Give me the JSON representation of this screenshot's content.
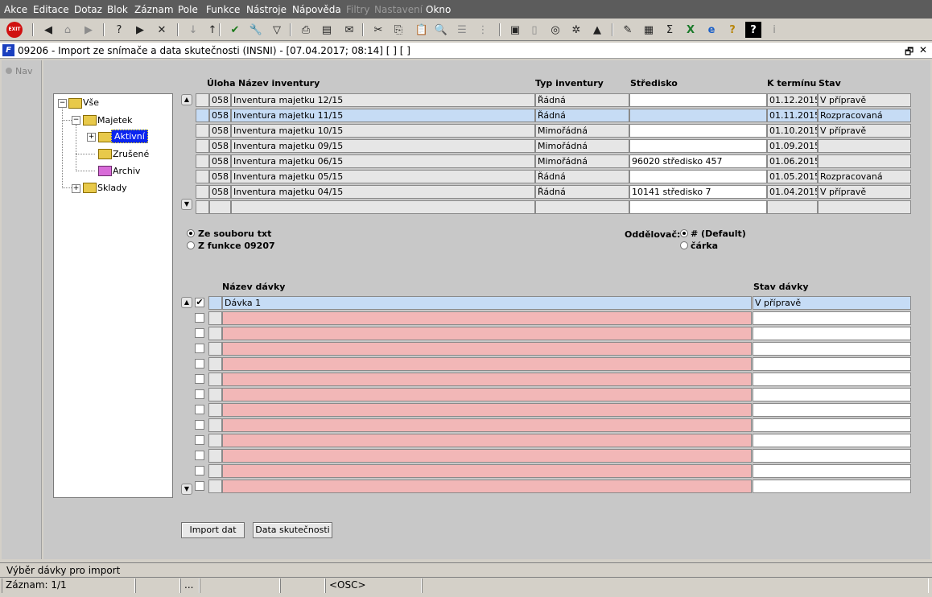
{
  "menu": [
    "Akce",
    "Editace",
    "Dotaz",
    "Blok",
    "Záznam",
    "Pole",
    "Funkce",
    "Nástroje",
    "Nápověda",
    "Filtry",
    "Nastavení",
    "Okno"
  ],
  "menu_disabled": [
    "Filtry",
    "Nastavení"
  ],
  "toolbar_icons": [
    "exit-icon",
    "previous-icon",
    "home-icon",
    "next-icon",
    "enter-query-icon",
    "execute-query-icon",
    "cancel-query-icon",
    "sort-asc-icon",
    "sort-desc-icon",
    "save-check-icon",
    "tools-icon",
    "filter-icon",
    "print-icon",
    "print-preview-icon",
    "mail-icon",
    "cut-icon",
    "copy-icon",
    "paste-icon",
    "find-icon",
    "list-icon",
    "tree-icon",
    "clipboard-icon",
    "document-icon",
    "globe-icon",
    "wheel-icon",
    "mountain-icon",
    "edit-icon",
    "chart-icon",
    "sum-icon",
    "excel-icon",
    "explorer-icon",
    "help-icon",
    "whats-this-icon",
    "info-icon"
  ],
  "exit_label": "EXIT",
  "window": {
    "title": "09206 - Import ze snímače a data skutečnosti (INSNI) - [07.04.2017; 08:14]  [ ]  [ ]",
    "restore": "🗗",
    "close": "✕"
  },
  "nav": {
    "label": "Nav"
  },
  "tree": {
    "root": "Vše",
    "majetek": "Majetek",
    "aktivni": "Aktivní",
    "zrusene": "Zrušené",
    "archiv": "Archiv",
    "sklady": "Sklady"
  },
  "inventory": {
    "headers": {
      "uloha": "Úloha",
      "nazev": "Název inventury",
      "typ": "Typ inventury",
      "stredisko": "Středisko",
      "termin": "K termínu",
      "stav": "Stav"
    },
    "rows": [
      {
        "uloha": "058",
        "nazev": "Inventura majetku 12/15",
        "typ": "Řádná",
        "stredisko": "",
        "termin": "01.12.2015",
        "stav": "V přípravě"
      },
      {
        "uloha": "058",
        "nazev": "Inventura majetku 11/15",
        "typ": "Řádná",
        "stredisko": "",
        "termin": "01.11.2015",
        "stav": "Rozpracovaná"
      },
      {
        "uloha": "058",
        "nazev": "Inventura majetku 10/15",
        "typ": "Mimořádná",
        "stredisko": "",
        "termin": "01.10.2015",
        "stav": "V přípravě"
      },
      {
        "uloha": "058",
        "nazev": "Inventura majetku 09/15",
        "typ": "Mimořádná",
        "stredisko": "",
        "termin": "01.09.2015",
        "stav": ""
      },
      {
        "uloha": "058",
        "nazev": "Inventura majetku 06/15",
        "typ": "Mimořádná",
        "stredisko": "96020 středisko 457",
        "termin": "01.06.2015",
        "stav": ""
      },
      {
        "uloha": "058",
        "nazev": "Inventura majetku 05/15",
        "typ": "Řádná",
        "stredisko": "",
        "termin": "01.05.2015",
        "stav": "Rozpracovaná"
      },
      {
        "uloha": "058",
        "nazev": "Inventura majetku 04/15",
        "typ": "Řádná",
        "stredisko": "10141 středisko 7",
        "termin": "01.04.2015",
        "stav": "V přípravě"
      },
      {
        "uloha": "",
        "nazev": "",
        "typ": "",
        "stredisko": "",
        "termin": "",
        "stav": ""
      }
    ],
    "selected_row": 1
  },
  "source": {
    "option1": "Ze souboru txt",
    "option2": "Z funkce 09207",
    "selected": 1
  },
  "separator": {
    "label": "Oddělovač:",
    "option1": "# (Default)",
    "option2": "čárka",
    "selected": 1
  },
  "batches": {
    "headers": {
      "nazev": "Název dávky",
      "stav": "Stav dávky"
    },
    "rows": [
      {
        "checked": true,
        "nazev": "Dávka 1",
        "stav": "V přípravě"
      },
      {
        "checked": false,
        "nazev": "",
        "stav": ""
      },
      {
        "checked": false,
        "nazev": "",
        "stav": ""
      },
      {
        "checked": false,
        "nazev": "",
        "stav": ""
      },
      {
        "checked": false,
        "nazev": "",
        "stav": ""
      },
      {
        "checked": false,
        "nazev": "",
        "stav": ""
      },
      {
        "checked": false,
        "nazev": "",
        "stav": ""
      },
      {
        "checked": false,
        "nazev": "",
        "stav": ""
      },
      {
        "checked": false,
        "nazev": "",
        "stav": ""
      },
      {
        "checked": false,
        "nazev": "",
        "stav": ""
      },
      {
        "checked": false,
        "nazev": "",
        "stav": ""
      },
      {
        "checked": false,
        "nazev": "",
        "stav": ""
      },
      {
        "checked": false,
        "nazev": "",
        "stav": ""
      }
    ]
  },
  "buttons": {
    "import": "Import dat",
    "data": "Data skutečnosti"
  },
  "status": {
    "hint": "Výběr dávky pro import",
    "record": "Záznam: 1/1",
    "dots": "...",
    "osc": "<OSC>"
  },
  "colors": {
    "menubar": "#5c5c5c",
    "selected_row": "#c6dcf5",
    "required_field": "#f2b7b7",
    "tree_selected": "#0a24f0"
  }
}
